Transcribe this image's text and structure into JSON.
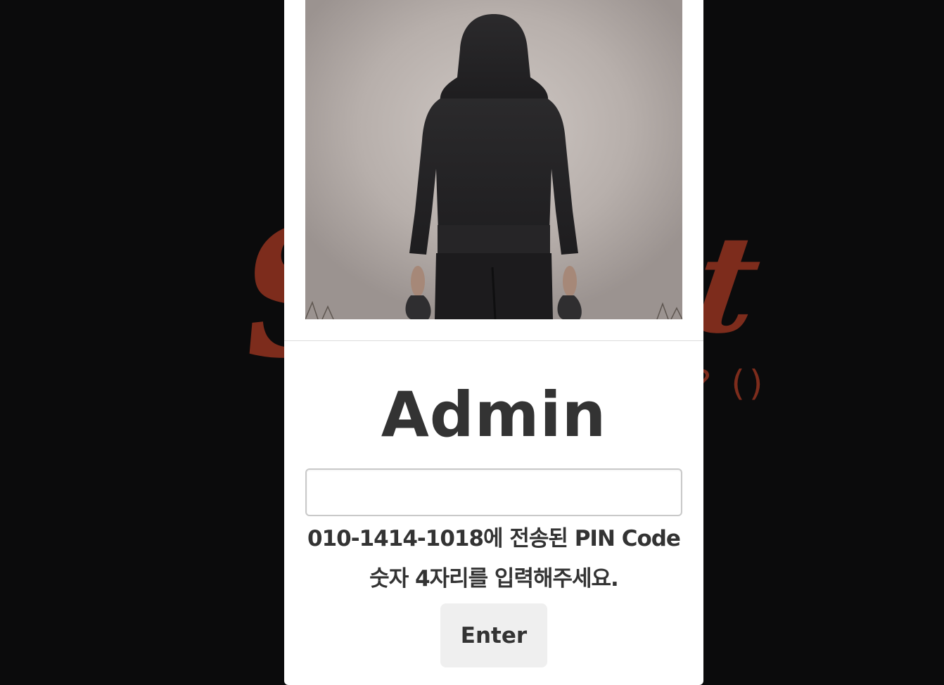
{
  "background": {
    "logo_left_text": "S",
    "logo_right_text": "t",
    "logo_sub_text": "? ()",
    "logo_color": "#7d2c1c",
    "page_color": "#0b0b0c"
  },
  "modal": {
    "title": "Admin",
    "photo_alt": "hooded figure",
    "pin_input": {
      "value": "",
      "placeholder": ""
    },
    "instruction": {
      "line1": "010-1414-1018에 전송된 PIN Code",
      "line2": "숫자 4자리를 입력해주세요."
    },
    "enter_label": "Enter"
  }
}
